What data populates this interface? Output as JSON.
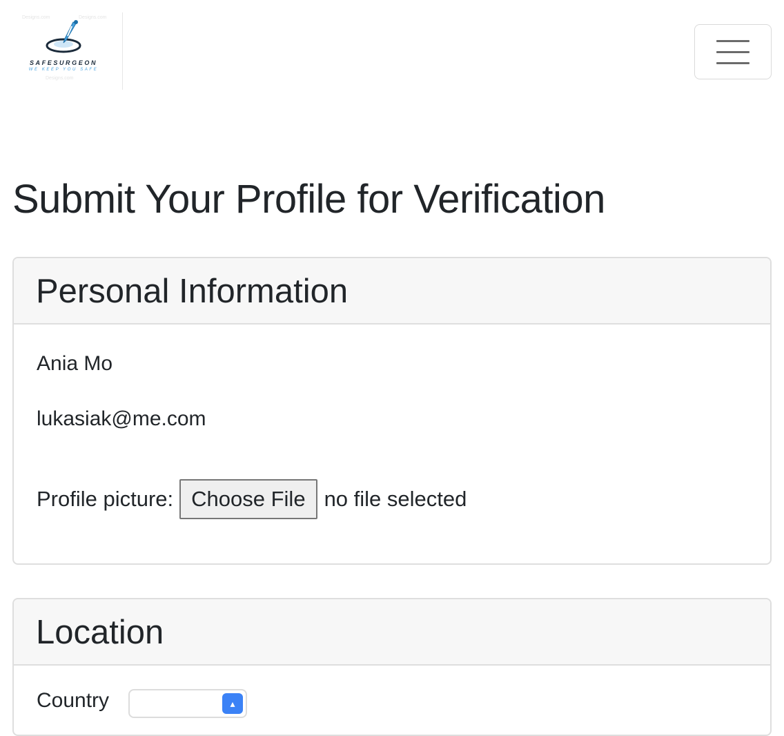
{
  "brand": {
    "name": "SAFESURGEON",
    "tagline": "WE KEEP YOU SAFE",
    "watermark": "Designs.com"
  },
  "navbar": {
    "toggler_icon": "hamburger-icon"
  },
  "page": {
    "title": "Submit Your Profile for Verification"
  },
  "personal_information": {
    "heading": "Personal Information",
    "name": "Ania Mo",
    "email": "lukasiak@me.com",
    "profile_picture": {
      "label": "Profile picture:",
      "button_label": "Choose File",
      "status": "no file selected"
    }
  },
  "location": {
    "heading": "Location",
    "country_label": "Country"
  },
  "colors": {
    "text": "#212529",
    "card_header_bg": "#f7f7f7",
    "card_border": "#dedede",
    "accent_blue": "#3b82f6",
    "logo_blue": "#4aa3df"
  }
}
